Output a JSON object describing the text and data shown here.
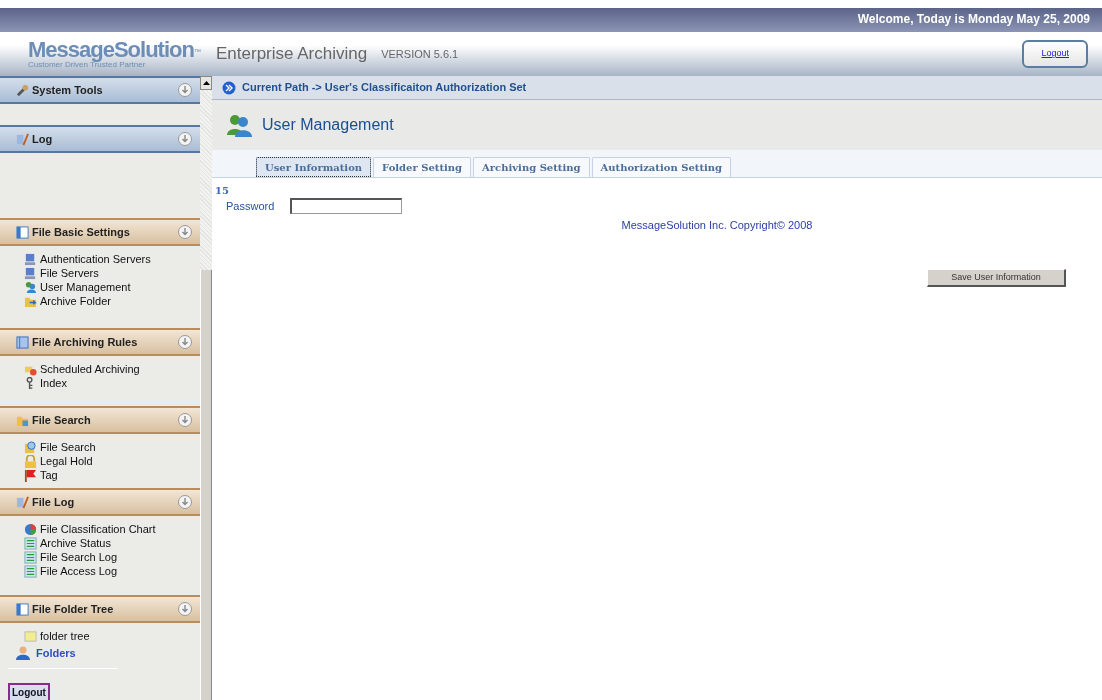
{
  "top_bar": {
    "welcome": "Welcome, Today is Monday May 25, 2009"
  },
  "header": {
    "logo": "MessageSolution",
    "logo_mark": "™",
    "tagline": "Customer Driven  Trusted Partner",
    "product": "Enterprise Archiving",
    "version": "VERSION 5.6.1",
    "logout": "Logout"
  },
  "sidebar": {
    "sections": [
      {
        "title": "System Tools",
        "kind": "blue"
      },
      {
        "title": "Log",
        "kind": "blue"
      },
      {
        "title": "File Basic Settings",
        "kind": "tan",
        "items": [
          {
            "label": "Authentication Servers"
          },
          {
            "label": "File Servers"
          },
          {
            "label": "User Management"
          },
          {
            "label": "Archive Folder"
          }
        ]
      },
      {
        "title": "File Archiving Rules",
        "kind": "tan",
        "items": [
          {
            "label": "Scheduled Archiving"
          },
          {
            "label": "Index"
          }
        ]
      },
      {
        "title": "File Search",
        "kind": "tan",
        "items": [
          {
            "label": "File Search"
          },
          {
            "label": "Legal Hold"
          },
          {
            "label": "Tag"
          }
        ]
      },
      {
        "title": "File Log",
        "kind": "tan",
        "items": [
          {
            "label": "File Classification Chart"
          },
          {
            "label": "Archive Status"
          },
          {
            "label": "File Search Log"
          },
          {
            "label": "File Access Log"
          }
        ]
      },
      {
        "title": "File Folder Tree",
        "kind": "tan",
        "items": [
          {
            "label": "folder tree"
          }
        ]
      }
    ],
    "folders": "Folders",
    "logout": "Logout"
  },
  "path": "Current Path -> User's Classificaiton Authorization Set",
  "page_title": "User Management",
  "tabs": [
    {
      "label": "User Information",
      "selected": true
    },
    {
      "label": "Folder Setting",
      "selected": false
    },
    {
      "label": "Archiving Setting",
      "selected": false
    },
    {
      "label": "Authorization Setting",
      "selected": false
    }
  ],
  "user_id": "15",
  "password": {
    "label": "Password"
  },
  "copyright": "MessageSolution Inc. Copyright© 2008",
  "save_button": "Save User Information"
}
